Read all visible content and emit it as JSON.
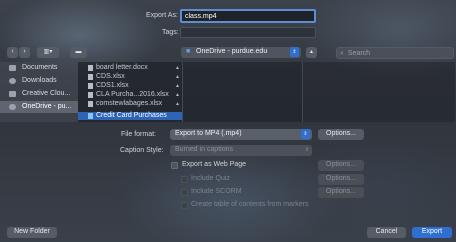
{
  "export": {
    "label": "Export As:",
    "value": "class.mp4"
  },
  "tags": {
    "label": "Tags:",
    "value": ""
  },
  "toolbar": {
    "location": "OneDrive - purdue.edu",
    "search_placeholder": "Search"
  },
  "sidebar": {
    "items": [
      {
        "label": "Documents"
      },
      {
        "label": "Downloads"
      },
      {
        "label": "Creative Clou..."
      },
      {
        "label": "OneDrive - pu..."
      }
    ]
  },
  "files": [
    {
      "name": "board letter.docx"
    },
    {
      "name": "CDS.xlsx"
    },
    {
      "name": "CDS1.xlsx"
    },
    {
      "name": "CLA Purcha...2016.xlsx"
    },
    {
      "name": "comstewlabages.xlsx"
    },
    {
      "name": "Credit Card Purchases"
    }
  ],
  "options": {
    "file_format": {
      "label": "File format:",
      "value": "Export to MP4 (.mp4)",
      "button": "Options..."
    },
    "caption_style": {
      "label": "Caption Style:",
      "value": "Burned in captions"
    },
    "web_page": {
      "label": "Export as Web Page",
      "button": "Options..."
    },
    "include_quiz": {
      "label": "Include Quiz",
      "button": "Options..."
    },
    "include_scorm": {
      "label": "Include SCORM",
      "button": "Options..."
    },
    "toc": {
      "label": "Create table of contents from markers"
    }
  },
  "footer": {
    "new_folder": "New Folder",
    "cancel": "Cancel",
    "export": "Export"
  },
  "colors": {
    "accent": "#2f6fd1",
    "focus_ring": "#5b8fd0"
  }
}
